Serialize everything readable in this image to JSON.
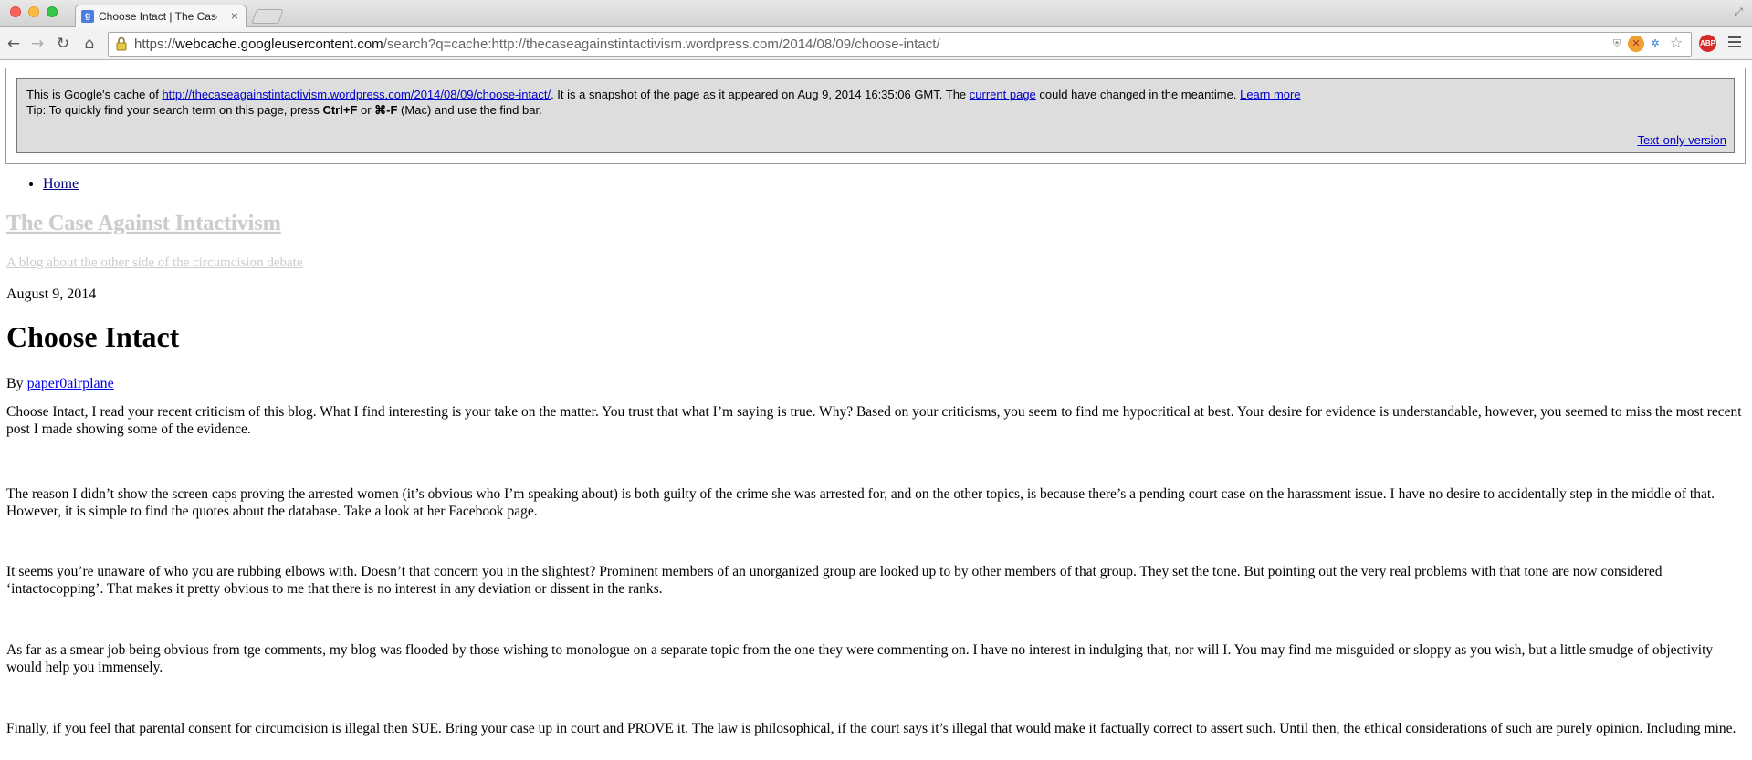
{
  "browser": {
    "tab_title": "Choose Intact | The Case A",
    "favicon_letter": "g",
    "url_scheme": "https://",
    "url_host": "webcache.googleusercontent.com",
    "url_path": "/search?q=cache:http://thecaseagainstintactivism.wordpress.com/2014/08/09/choose-intact/",
    "abp_label": "ABP"
  },
  "cache_banner": {
    "intro": "This is Google's cache of ",
    "cached_url": "http://thecaseagainstintactivism.wordpress.com/2014/08/09/choose-intact/",
    "snapshot_text": ". It is a snapshot of the page as it appeared on Aug 9, 2014 16:35:06 GMT. The ",
    "current_page_link": "current page",
    "changed_text": " could have changed in the meantime. ",
    "learn_more_link": "Learn more",
    "tip_prefix": "Tip: To quickly find your search term on this page, press ",
    "tip_key1": "Ctrl+F",
    "tip_or": " or ",
    "tip_key2": "⌘-F",
    "tip_suffix": " (Mac) and use the find bar.",
    "text_only_link": "Text-only version"
  },
  "page": {
    "nav_items": [
      "Home"
    ],
    "site_title": "The Case Against Intactivism",
    "site_description": "A blog about the other side of the circumcision debate",
    "post_date": "August 9, 2014",
    "post_title": "Choose Intact",
    "by_label": "By ",
    "author": "paper0airplane",
    "paragraphs": [
      "Choose Intact, I read your recent criticism of this blog.  What I find interesting is your take on the matter.  You trust that what I’m saying is true. Why?  Based on your criticisms, you seem to find me hypocritical at best.   Your desire for evidence is understandable, however, you seemed to miss the most recent post I made showing some of the evidence.",
      "The reason I didn’t show the screen caps proving the arrested women (it’s obvious who I’m speaking about) is both guilty of the crime she was arrested for,  and on the other topics, is because there’s a pending court case on the harassment issue. I have no desire to accidentally step in the middle of that.  However, it is simple to find the quotes about the database. Take a look at her Facebook page.",
      "It seems you’re unaware of who you are rubbing elbows with.  Doesn’t that concern you in the slightest?  Prominent members of an unorganized group are looked up to by other members of that group.  They set the tone. But pointing out the very real problems with that tone are now considered ‘intactocopping’.  That makes it pretty obvious to me that there is no interest in any deviation or dissent in the ranks.",
      "As far as a smear job being obvious from tge comments, my blog was flooded by those wishing to monologue on a separate topic from the one they were commenting on.  I have no interest in indulging that, nor will I.  You may find me misguided or sloppy as you wish, but a little smudge of objectivity would help you immensely.",
      "Finally, if you feel that parental consent for circumcision is illegal then SUE.  Bring your case up in court and PROVE it. The law is philosophical, if the court says it’s illegal that would make it factually correct to assert such.  Until then, the ethical considerations of such are purely opinion.  Including mine."
    ]
  }
}
